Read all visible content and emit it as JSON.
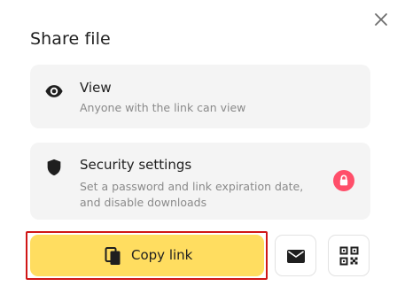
{
  "dialog": {
    "title": "Share file",
    "close_icon": "close-icon"
  },
  "access": {
    "label": "View",
    "description": "Anyone with the link can view",
    "icon": "eye-icon"
  },
  "security": {
    "label": "Security settings",
    "description_line1": "Set a password and link expiration date,",
    "description_line2": "and disable downloads",
    "icon": "shield-icon",
    "badge_icon": "lock-icon",
    "badge_color": "#ff4f6a"
  },
  "actions": {
    "copy_label": "Copy link",
    "copy_icon": "copy-icon",
    "copy_color": "#ffdd60",
    "email_icon": "mail-icon",
    "qr_icon": "qr-code-icon"
  }
}
